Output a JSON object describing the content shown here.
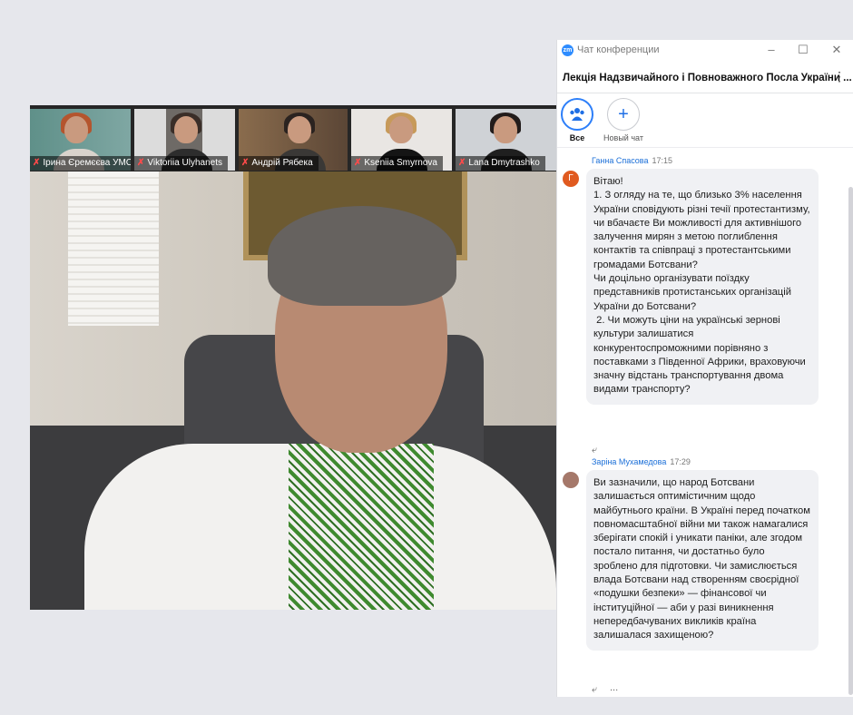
{
  "participants": [
    {
      "name": "Ірина Єремєєва УМСФ",
      "muted": true
    },
    {
      "name": "Viktoriia Ulyhanets",
      "muted": true
    },
    {
      "name": "Андрій Рябека",
      "muted": true
    },
    {
      "name": "Kseniia Smyrnova",
      "muted": true
    },
    {
      "name": "Lana Dmytrashko",
      "muted": true
    }
  ],
  "chat_window": {
    "logo": "zm",
    "title": "Чат конференции",
    "conference_title": "Лекція Надзвичайного і Повноважного Посла України ...",
    "more_label": "...",
    "tabs": [
      {
        "label": "Все",
        "icon": "people-group-icon",
        "active": true
      },
      {
        "label": "Новый чат",
        "icon": "plus-icon",
        "active": false
      }
    ]
  },
  "messages": [
    {
      "sender": "Ганна Спасова",
      "time": "17:15",
      "avatar_letter": "Г",
      "avatar_color": "#e05a1f",
      "text": "Вітаю!\n1. З огляду на те, що близько 3% населення України сповідують різні течії протестантизму, чи вбачаєте Ви можливості для активнішого залучення мирян з метою поглиблення контактів та співпраці з протестантськими громадами Ботсвани?\nЧи доцільно організувати поїздку представників протистанських організацій України до Ботсвани?\n 2. Чи можуть ціни на українські зернові культури залишатися конкурентоспроможними порівняно з поставками з Південної Африки, враховуючи значну відстань транспортування двома видами транспорту?"
    },
    {
      "sender": "Заріна Мухамедова",
      "time": "17:29",
      "avatar_letter": "",
      "avatar_color": "#a5786a",
      "text": "Ви зазначили, що народ Ботсвани залишається оптимістичним щодо майбутнього країни. В Україні перед початком повномасштабної війни ми також намагалися зберігати спокій і уникати паніки, але згодом постало питання, чи достатньо було зроблено для підготовки. Чи замислюється влада Ботсвани над створенням своєрідної «подушки безпеки» — фінансової чи інституційної — аби у разі виникнення непередбачуваних викликів країна залишалася захищеною?"
    }
  ],
  "message_actions": {
    "more": "..."
  }
}
